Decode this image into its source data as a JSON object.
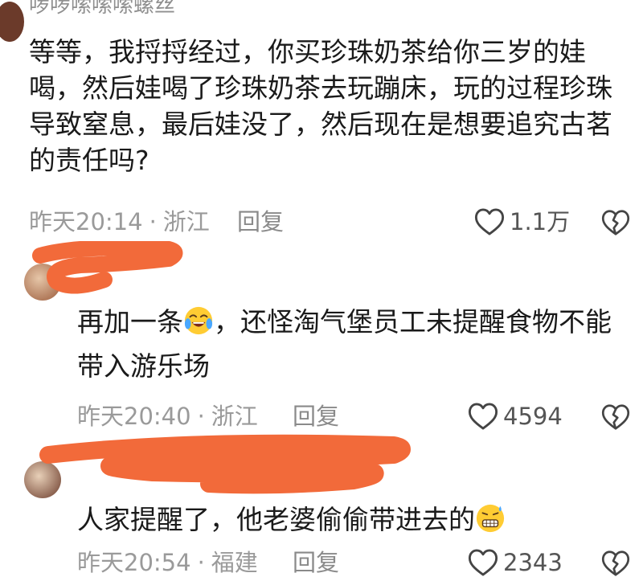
{
  "comments": [
    {
      "username": "啰啰嗦嗦嗦螺丝",
      "lines": [
        "等等，我捋捋经过，你买珍珠奶茶给你三岁的娃",
        "喝，然后娃喝了珍珠奶茶去玩蹦床，玩的过程珍珠",
        "导致窒息，最后娃没了，然后现在是想要追究古茗",
        "的责任吗?"
      ],
      "time": "昨天20:14",
      "location": "浙江",
      "reply_label": "回复",
      "likes": "1.1万"
    },
    {
      "text_before_emoji": "再加一条",
      "emoji": "crying-laughing-emoji",
      "text_after_emoji": "，还怪淘气堡员工未提醒食物不能",
      "line2": "带入游乐场",
      "time": "昨天20:40",
      "location": "浙江",
      "reply_label": "回复",
      "likes": "4594"
    },
    {
      "text": "人家提醒了，他老婆偷偷带进去的",
      "emoji": "grimacing-sweat-emoji",
      "time": "昨天20:54",
      "location": "福建",
      "reply_label": "回复",
      "likes": "2343"
    }
  ],
  "separator": "·",
  "colors": {
    "meta": "#9a9a9a",
    "redaction": "#f26a3a"
  }
}
